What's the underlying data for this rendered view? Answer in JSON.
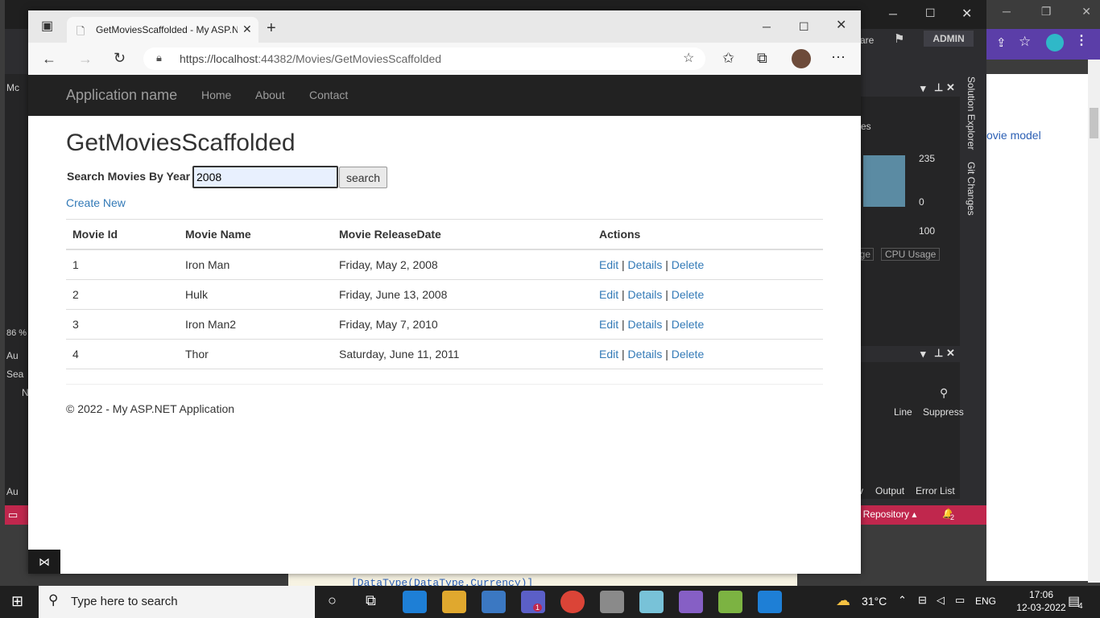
{
  "vs": {
    "admin_badge": "ADMIN",
    "share_label": "are",
    "left_labels": [
      "Mc",
      "86 %",
      "Au",
      "Sea",
      "N",
      "Au"
    ],
    "chart_values": [
      "235",
      "0",
      "100"
    ],
    "chart_title": "es",
    "usage_tabs": [
      "age",
      "CPU Usage"
    ],
    "error_columns": [
      "Line",
      "Suppress"
    ],
    "side_tabs": [
      "Solution Explorer",
      "Git Changes"
    ],
    "bottom_tabs": [
      "v",
      "Output",
      "Error List"
    ],
    "status_text": "t Repository",
    "notification_count": "2"
  },
  "doc": {
    "link_text": "ovie model",
    "code_line": "[DataType(DataType.Currency)]"
  },
  "browser": {
    "tab_title": "GetMoviesScaffolded - My ASP.NET Application",
    "url_host": "https://localhost",
    "url_rest": ":44382/Movies/GetMoviesScaffolded"
  },
  "page": {
    "brand": "Application name",
    "nav": [
      "Home",
      "About",
      "Contact"
    ],
    "title": "GetMoviesScaffolded",
    "search_label": "Search Movies By Year",
    "search_value": "2008",
    "search_button": "search",
    "create_new": "Create New",
    "columns": [
      "Movie Id",
      "Movie Name",
      "Movie ReleaseDate",
      "Actions"
    ],
    "rows": [
      {
        "id": "1",
        "name": "Iron Man",
        "date": "Friday, May 2, 2008"
      },
      {
        "id": "2",
        "name": "Hulk",
        "date": "Friday, June 13, 2008"
      },
      {
        "id": "3",
        "name": "Iron Man2",
        "date": "Friday, May 7, 2010"
      },
      {
        "id": "4",
        "name": "Thor",
        "date": "Saturday, June 11, 2011"
      }
    ],
    "actions": {
      "edit": "Edit",
      "sep": "|",
      "details": "Details",
      "delete": "Delete"
    },
    "footer": "© 2022 - My ASP.NET Application"
  },
  "taskbar": {
    "search_placeholder": "Type here to search",
    "teams_badge": "1",
    "weather": "31°C",
    "language": "ENG",
    "time": "17:06",
    "date": "12-03-2022",
    "notifications": "4"
  },
  "colors": {
    "navbar": "#222222",
    "link": "#337ab7",
    "vs_status": "#c0274d"
  }
}
